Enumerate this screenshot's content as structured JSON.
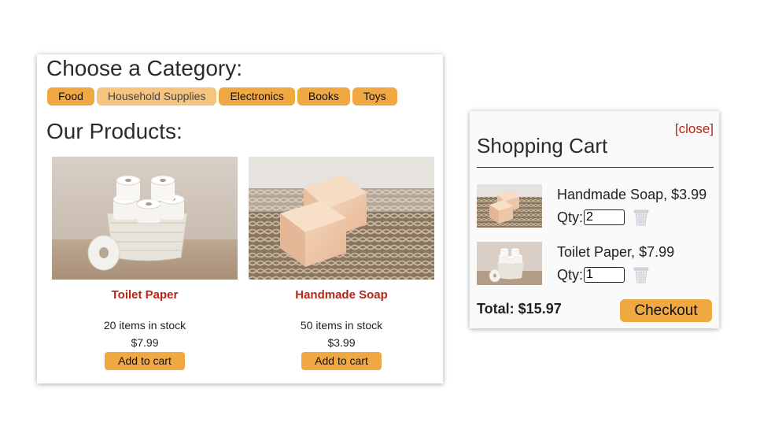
{
  "shop": {
    "category_heading": "Choose a Category:",
    "categories": [
      {
        "label": "Food",
        "active": false
      },
      {
        "label": "Household Supplies",
        "active": true
      },
      {
        "label": "Electronics",
        "active": false
      },
      {
        "label": "Books",
        "active": false
      },
      {
        "label": "Toys",
        "active": false
      }
    ],
    "products_heading": "Our Products:",
    "products": [
      {
        "name": "Toilet Paper",
        "stock": "20 items in stock",
        "price": "$7.99",
        "add_label": "Add to cart",
        "image_icon": "toilet-paper-basket"
      },
      {
        "name": "Handmade Soap",
        "stock": "50 items in stock",
        "price": "$3.99",
        "add_label": "Add to cart",
        "image_icon": "soap-bars"
      }
    ]
  },
  "cart": {
    "close_label": "[close]",
    "title": "Shopping Cart",
    "qty_label": "Qty:",
    "items": [
      {
        "name": "Handmade Soap, $3.99",
        "qty": "2",
        "image_icon": "soap-bars"
      },
      {
        "name": "Toilet Paper, $7.99",
        "qty": "1",
        "image_icon": "toilet-paper-basket"
      }
    ],
    "total": "Total: $15.97",
    "checkout_label": "Checkout"
  },
  "colors": {
    "accent": "#f0a842",
    "accent_active": "#f6c47f",
    "product_name": "#b0281a",
    "close_link": "#b0281a"
  }
}
